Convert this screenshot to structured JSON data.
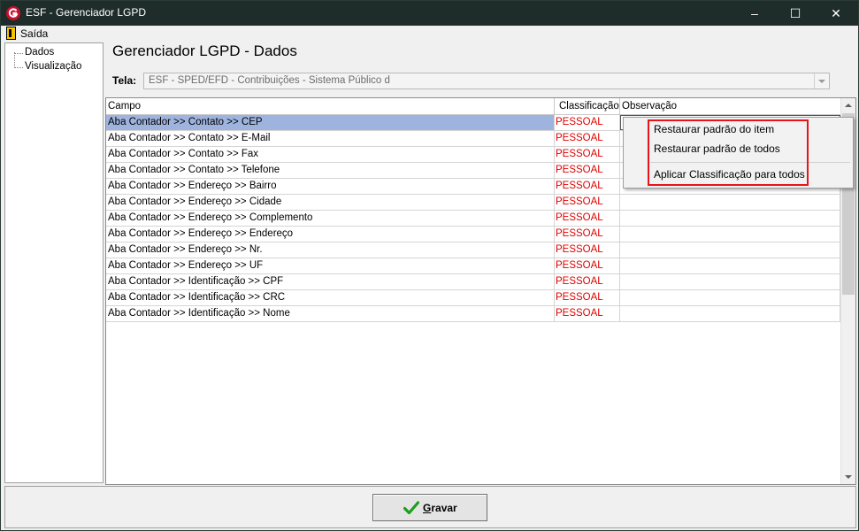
{
  "window": {
    "title": "ESF - Gerenciador LGPD",
    "minimize": "–",
    "maximize": "☐",
    "close": "✕"
  },
  "menu": {
    "exit_label": "Saída"
  },
  "tree": {
    "items": [
      "Dados",
      "Visualização"
    ]
  },
  "page": {
    "title": "Gerenciador LGPD - Dados"
  },
  "screen_filter": {
    "label": "Tela:",
    "value": "ESF - SPED/EFD - Contribuições - Sistema Público d"
  },
  "grid": {
    "headers": [
      "Campo",
      "Classificação",
      "Observação"
    ],
    "rows": [
      {
        "campo": "Aba Contador >> Contato >> CEP",
        "classificacao": "PESSOAL",
        "observacao": ""
      },
      {
        "campo": "Aba Contador >> Contato >> E-Mail",
        "classificacao": "PESSOAL",
        "observacao": ""
      },
      {
        "campo": "Aba Contador >> Contato >> Fax",
        "classificacao": "PESSOAL",
        "observacao": ""
      },
      {
        "campo": "Aba Contador >> Contato >> Telefone",
        "classificacao": "PESSOAL",
        "observacao": ""
      },
      {
        "campo": "Aba Contador >> Endereço >> Bairro",
        "classificacao": "PESSOAL",
        "observacao": ""
      },
      {
        "campo": "Aba Contador >> Endereço >> Cidade",
        "classificacao": "PESSOAL",
        "observacao": ""
      },
      {
        "campo": "Aba Contador >> Endereço >> Complemento",
        "classificacao": "PESSOAL",
        "observacao": ""
      },
      {
        "campo": "Aba Contador >> Endereço >> Endereço",
        "classificacao": "PESSOAL",
        "observacao": ""
      },
      {
        "campo": "Aba Contador >> Endereço >> Nr.",
        "classificacao": "PESSOAL",
        "observacao": ""
      },
      {
        "campo": "Aba Contador >> Endereço >> UF",
        "classificacao": "PESSOAL",
        "observacao": ""
      },
      {
        "campo": "Aba Contador >> Identificação >> CPF",
        "classificacao": "PESSOAL",
        "observacao": ""
      },
      {
        "campo": "Aba Contador >> Identificação >> CRC",
        "classificacao": "PESSOAL",
        "observacao": ""
      },
      {
        "campo": "Aba Contador >> Identificação >> Nome",
        "classificacao": "PESSOAL",
        "observacao": ""
      }
    ]
  },
  "context_menu": {
    "items": [
      "Restaurar padrão do item",
      "Restaurar padrão de todos",
      "Aplicar Classificação para todos"
    ]
  },
  "footer": {
    "save_label": "Gravar"
  },
  "colors": {
    "classification_text": "#e00000",
    "selected_row": "#9eb4df",
    "highlight_border": "#e8141b",
    "check_green": "#1e9e1e"
  }
}
